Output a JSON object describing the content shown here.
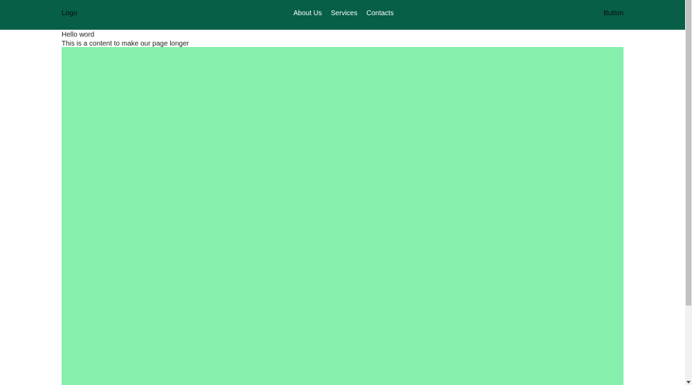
{
  "header": {
    "logo": "Logo",
    "nav": [
      {
        "label": "About Us"
      },
      {
        "label": "Services"
      },
      {
        "label": "Contacts"
      }
    ],
    "button_label": "Button"
  },
  "main": {
    "heading": "Hello word",
    "subtext": "This is a content to make our page longer"
  },
  "colors": {
    "header_bg": "#065f46",
    "box_bg": "#86efac"
  }
}
